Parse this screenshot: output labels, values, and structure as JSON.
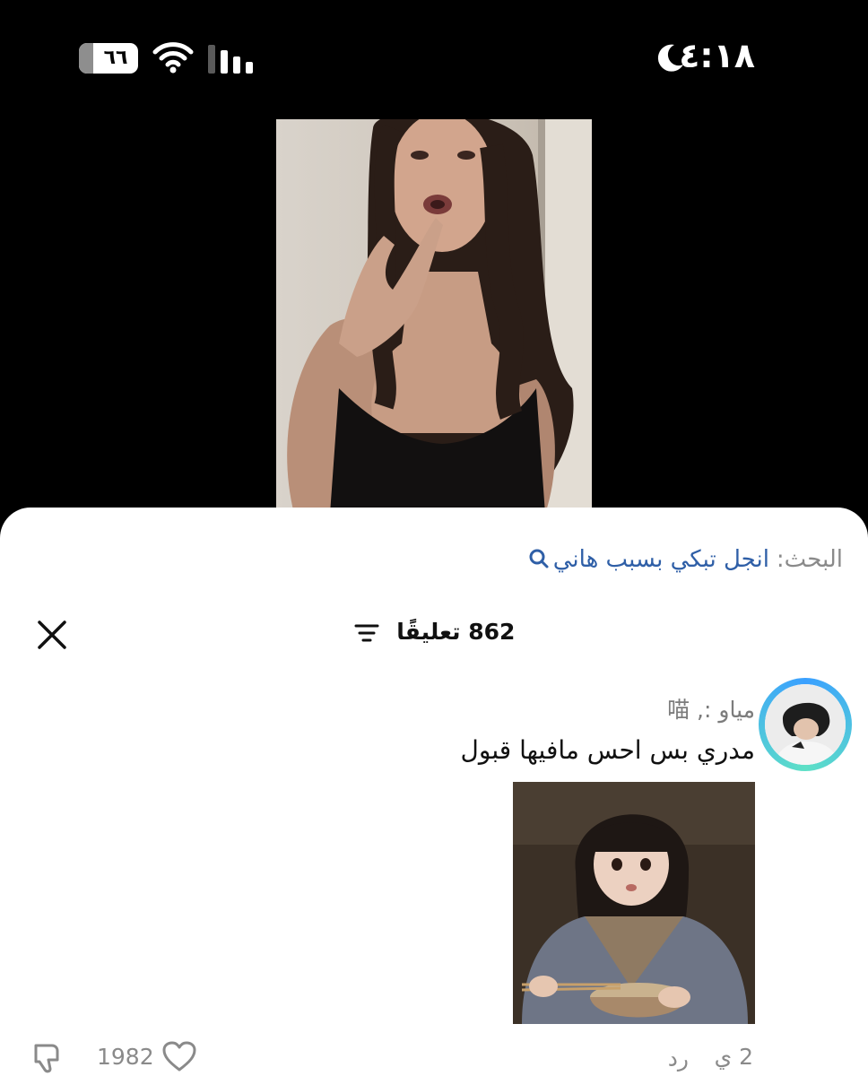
{
  "status_bar": {
    "time": "٤:١٨",
    "battery": "٦٦"
  },
  "sheet": {
    "search_label": "البحث:",
    "search_query": "انجل تبكي بسبب هاني",
    "comment_count": "862 تعليقًا"
  },
  "comment": {
    "username": "مياو :, 喵",
    "text": "مدري بس احس مافيها قبول",
    "age": "2 ي",
    "reply_label": "رد",
    "like_count": "1982"
  },
  "colors": {
    "search_link": "#2f5fa7",
    "avatar_ring": "#3aa0ff"
  }
}
